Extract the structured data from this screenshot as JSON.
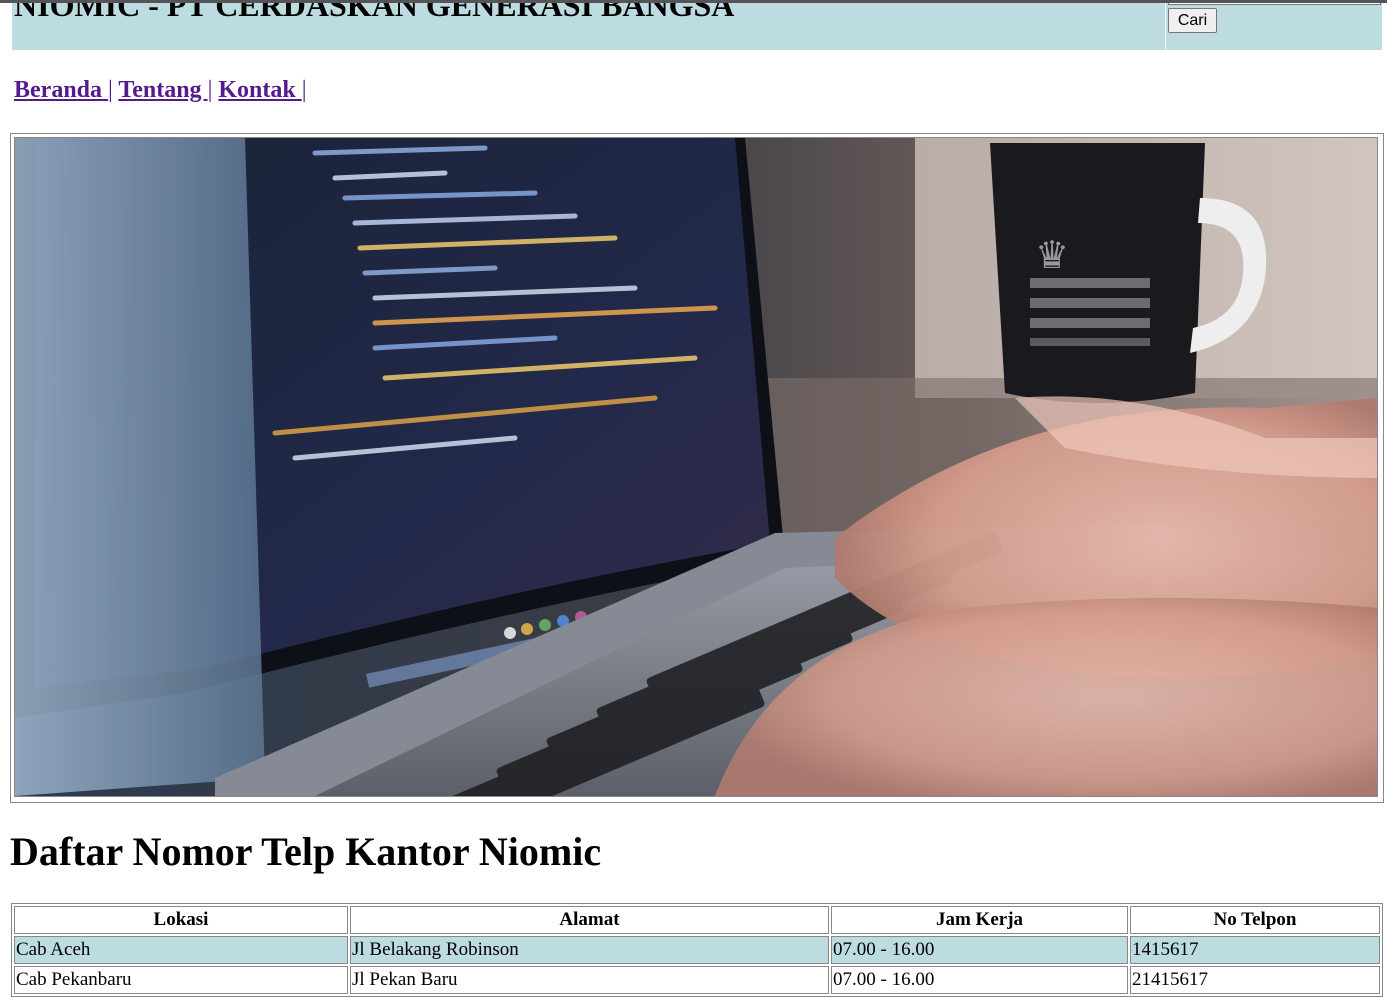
{
  "header": {
    "title": "NIOMIC - PT CERDASKAN GENERASI BANGSA",
    "search_placeholder": "",
    "search_button": "Cari"
  },
  "nav": {
    "items": [
      {
        "label": "Beranda "
      },
      {
        "label": "Tentang "
      },
      {
        "label": "Kontak "
      }
    ],
    "separator": "|"
  },
  "hero": {
    "image": "laptop-coding-photo"
  },
  "section": {
    "title": "Daftar Nomor Telp Kantor Niomic"
  },
  "table": {
    "headers": [
      "Lokasi",
      "Alamat",
      "Jam Kerja",
      "No Telpon"
    ],
    "rows": [
      [
        "Cab Aceh",
        "Jl Belakang Robinson",
        "07.00 - 16.00",
        "1415617"
      ],
      [
        "Cab Pekanbaru",
        "Jl Pekan Baru",
        "07.00 - 16.00",
        "21415617"
      ]
    ]
  },
  "colors": {
    "header_bg": "#bcdce1",
    "row_alt_bg": "#bcdce1",
    "link": "#551a8b"
  }
}
